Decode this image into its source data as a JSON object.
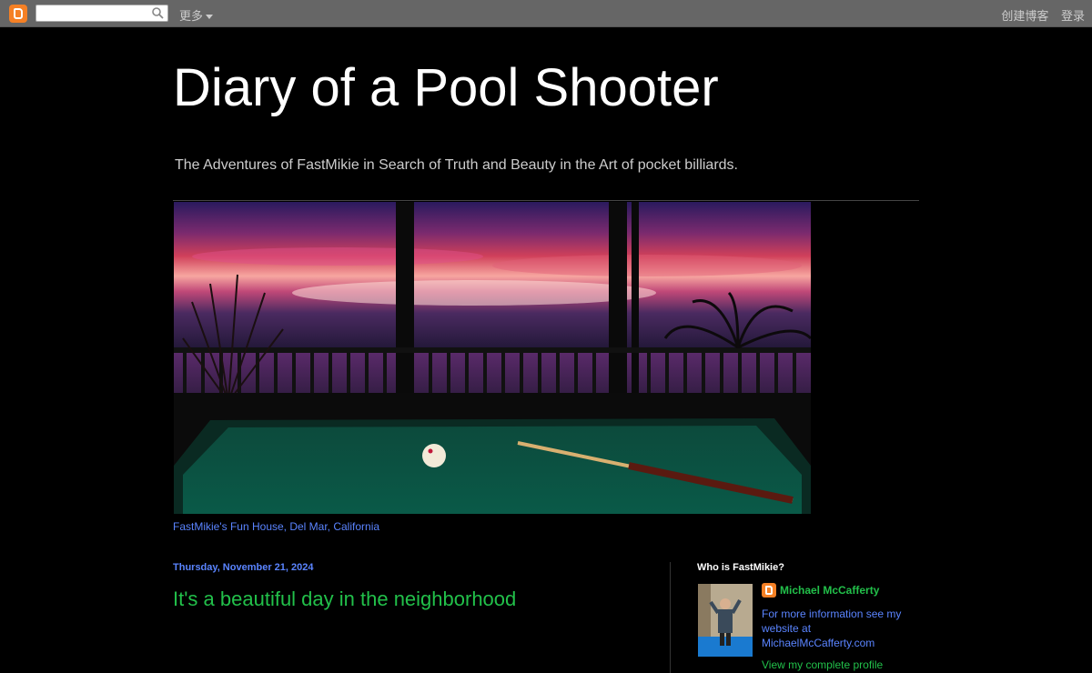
{
  "navbar": {
    "more_label": "更多",
    "create_blog": "创建博客",
    "login": "登录"
  },
  "header": {
    "title": "Diary of a Pool Shooter",
    "description": "The Adventures of FastMikie in Search of Truth and Beauty in the Art of pocket billiards.",
    "image_caption": "FastMikie's Fun House, Del Mar, California"
  },
  "post": {
    "date": "Thursday, November 21, 2024",
    "title": "It's a beautiful day in the neighborhood"
  },
  "sidebar": {
    "heading": "Who is FastMikie?",
    "profile_name": "Michael McCafferty",
    "about": "For more information see my website at MichaelMcCafferty.com",
    "profile_link": "View my complete profile"
  },
  "colors": {
    "background": "#000000",
    "navbar": "#666666",
    "link_blue": "#5a84ff",
    "link_green": "#22c04a",
    "blogger_orange": "#f58025"
  }
}
